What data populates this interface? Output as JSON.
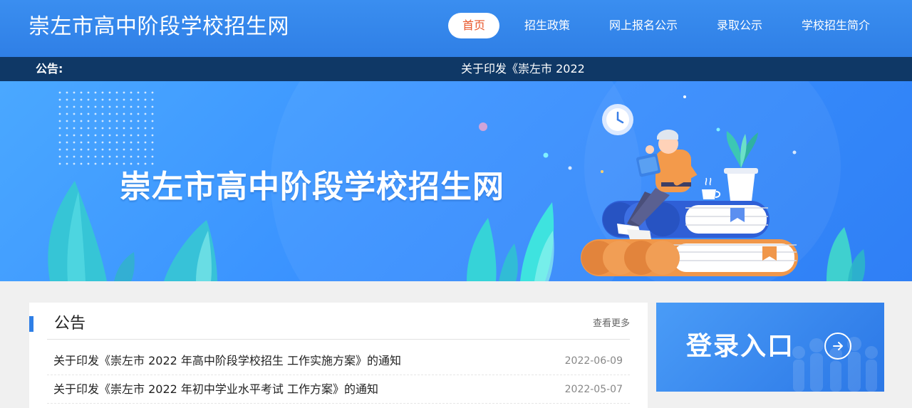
{
  "header": {
    "site_title": "崇左市高中阶段学校招生网",
    "nav": [
      {
        "label": "首页",
        "active": true
      },
      {
        "label": "招生政策",
        "active": false
      },
      {
        "label": "网上报名公示",
        "active": false
      },
      {
        "label": "录取公示",
        "active": false
      },
      {
        "label": "学校招生简介",
        "active": false
      }
    ]
  },
  "notice_bar": {
    "label": "公告:",
    "marquee_text": "关于印发《崇左市 2022"
  },
  "banner": {
    "title": "崇左市高中阶段学校招生网"
  },
  "notice_panel": {
    "title": "公告",
    "more_label": "查看更多",
    "items": [
      {
        "title": "关于印发《崇左市 2022 年高中阶段学校招生 工作实施方案》的通知",
        "date": "2022-06-09"
      },
      {
        "title": "关于印发《崇左市 2022 年初中学业水平考试 工作方案》的通知",
        "date": "2022-05-07"
      }
    ]
  },
  "login_card": {
    "label": "登录入口"
  },
  "colors": {
    "header_blue": "#2f7fe6",
    "notice_bar_navy": "#0f3866",
    "active_nav_text": "#e8562a",
    "page_bg": "#f0f0f0"
  }
}
